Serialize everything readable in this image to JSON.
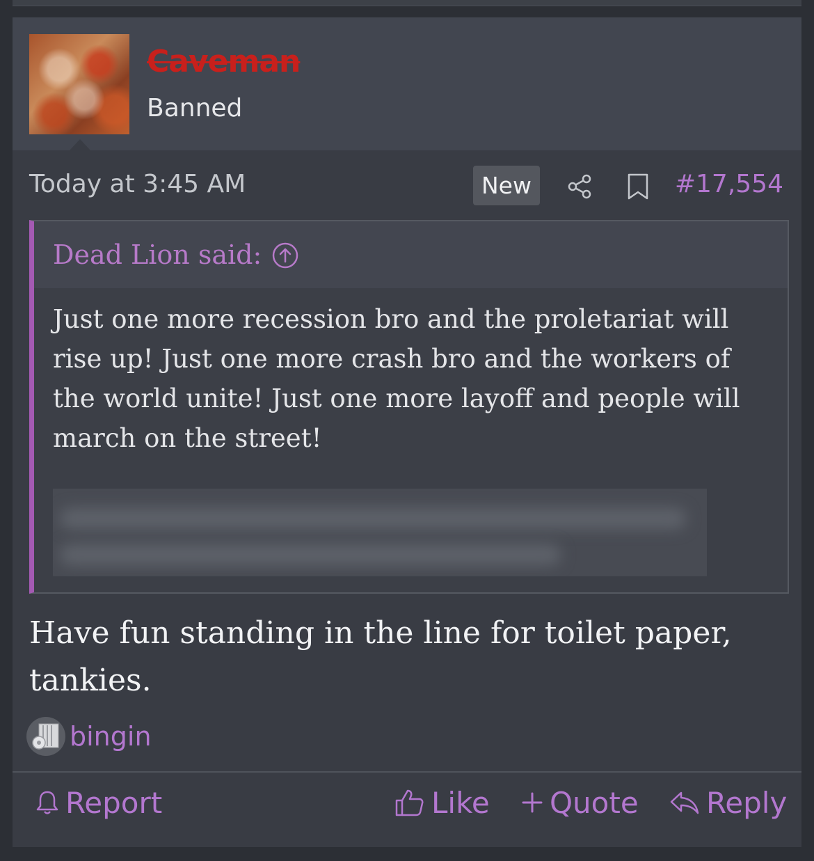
{
  "post": {
    "author": {
      "name": "Caveman",
      "title": "Banned"
    },
    "timestamp": "Today at 3:45 AM",
    "new_badge": "New",
    "post_number": "#17,554",
    "quote": {
      "author_label": "Dead Lion said:",
      "text": "Just one more recession bro and the proletariat will rise up! Just one more crash bro and the workers of the world unite! Just one more layoff and people will march on the street!"
    },
    "body": "Have fun standing in the line for toilet paper, tankies.",
    "reactions": {
      "users": "bingin"
    },
    "actions": {
      "report": "Report",
      "like": "Like",
      "quote": "Quote",
      "reply": "Reply"
    }
  },
  "colors": {
    "accent": "#b377cf",
    "banned_username": "#c8201c",
    "quote_border": "#a45ab3"
  },
  "icons": [
    "share-icon",
    "bookmark-icon",
    "arrow-up-circle-icon",
    "bell-icon",
    "thumbs-up-icon",
    "plus-icon",
    "reply-arrow-icon"
  ]
}
